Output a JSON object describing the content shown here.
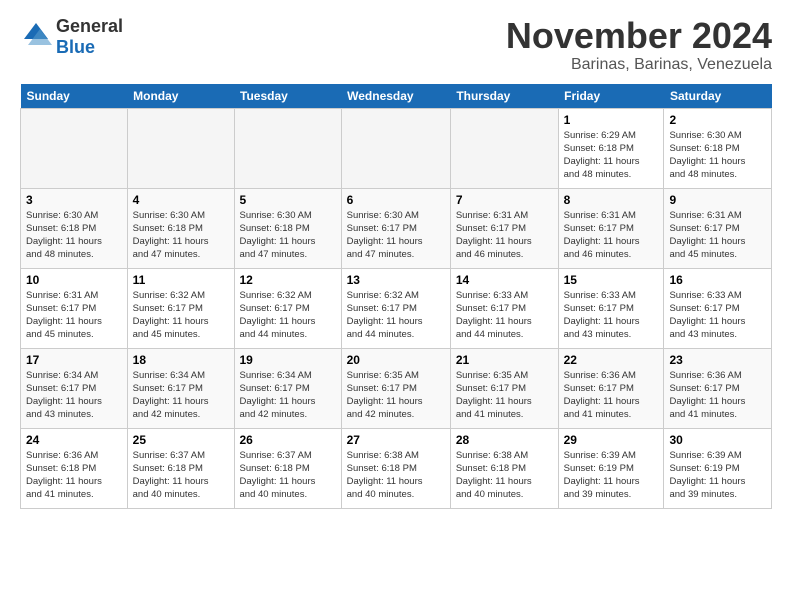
{
  "logo": {
    "general": "General",
    "blue": "Blue"
  },
  "title": "November 2024",
  "subtitle": "Barinas, Barinas, Venezuela",
  "headers": [
    "Sunday",
    "Monday",
    "Tuesday",
    "Wednesday",
    "Thursday",
    "Friday",
    "Saturday"
  ],
  "weeks": [
    [
      {
        "day": "",
        "detail": ""
      },
      {
        "day": "",
        "detail": ""
      },
      {
        "day": "",
        "detail": ""
      },
      {
        "day": "",
        "detail": ""
      },
      {
        "day": "",
        "detail": ""
      },
      {
        "day": "1",
        "detail": "Sunrise: 6:29 AM\nSunset: 6:18 PM\nDaylight: 11 hours\nand 48 minutes."
      },
      {
        "day": "2",
        "detail": "Sunrise: 6:30 AM\nSunset: 6:18 PM\nDaylight: 11 hours\nand 48 minutes."
      }
    ],
    [
      {
        "day": "3",
        "detail": "Sunrise: 6:30 AM\nSunset: 6:18 PM\nDaylight: 11 hours\nand 48 minutes."
      },
      {
        "day": "4",
        "detail": "Sunrise: 6:30 AM\nSunset: 6:18 PM\nDaylight: 11 hours\nand 47 minutes."
      },
      {
        "day": "5",
        "detail": "Sunrise: 6:30 AM\nSunset: 6:18 PM\nDaylight: 11 hours\nand 47 minutes."
      },
      {
        "day": "6",
        "detail": "Sunrise: 6:30 AM\nSunset: 6:17 PM\nDaylight: 11 hours\nand 47 minutes."
      },
      {
        "day": "7",
        "detail": "Sunrise: 6:31 AM\nSunset: 6:17 PM\nDaylight: 11 hours\nand 46 minutes."
      },
      {
        "day": "8",
        "detail": "Sunrise: 6:31 AM\nSunset: 6:17 PM\nDaylight: 11 hours\nand 46 minutes."
      },
      {
        "day": "9",
        "detail": "Sunrise: 6:31 AM\nSunset: 6:17 PM\nDaylight: 11 hours\nand 45 minutes."
      }
    ],
    [
      {
        "day": "10",
        "detail": "Sunrise: 6:31 AM\nSunset: 6:17 PM\nDaylight: 11 hours\nand 45 minutes."
      },
      {
        "day": "11",
        "detail": "Sunrise: 6:32 AM\nSunset: 6:17 PM\nDaylight: 11 hours\nand 45 minutes."
      },
      {
        "day": "12",
        "detail": "Sunrise: 6:32 AM\nSunset: 6:17 PM\nDaylight: 11 hours\nand 44 minutes."
      },
      {
        "day": "13",
        "detail": "Sunrise: 6:32 AM\nSunset: 6:17 PM\nDaylight: 11 hours\nand 44 minutes."
      },
      {
        "day": "14",
        "detail": "Sunrise: 6:33 AM\nSunset: 6:17 PM\nDaylight: 11 hours\nand 44 minutes."
      },
      {
        "day": "15",
        "detail": "Sunrise: 6:33 AM\nSunset: 6:17 PM\nDaylight: 11 hours\nand 43 minutes."
      },
      {
        "day": "16",
        "detail": "Sunrise: 6:33 AM\nSunset: 6:17 PM\nDaylight: 11 hours\nand 43 minutes."
      }
    ],
    [
      {
        "day": "17",
        "detail": "Sunrise: 6:34 AM\nSunset: 6:17 PM\nDaylight: 11 hours\nand 43 minutes."
      },
      {
        "day": "18",
        "detail": "Sunrise: 6:34 AM\nSunset: 6:17 PM\nDaylight: 11 hours\nand 42 minutes."
      },
      {
        "day": "19",
        "detail": "Sunrise: 6:34 AM\nSunset: 6:17 PM\nDaylight: 11 hours\nand 42 minutes."
      },
      {
        "day": "20",
        "detail": "Sunrise: 6:35 AM\nSunset: 6:17 PM\nDaylight: 11 hours\nand 42 minutes."
      },
      {
        "day": "21",
        "detail": "Sunrise: 6:35 AM\nSunset: 6:17 PM\nDaylight: 11 hours\nand 41 minutes."
      },
      {
        "day": "22",
        "detail": "Sunrise: 6:36 AM\nSunset: 6:17 PM\nDaylight: 11 hours\nand 41 minutes."
      },
      {
        "day": "23",
        "detail": "Sunrise: 6:36 AM\nSunset: 6:17 PM\nDaylight: 11 hours\nand 41 minutes."
      }
    ],
    [
      {
        "day": "24",
        "detail": "Sunrise: 6:36 AM\nSunset: 6:18 PM\nDaylight: 11 hours\nand 41 minutes."
      },
      {
        "day": "25",
        "detail": "Sunrise: 6:37 AM\nSunset: 6:18 PM\nDaylight: 11 hours\nand 40 minutes."
      },
      {
        "day": "26",
        "detail": "Sunrise: 6:37 AM\nSunset: 6:18 PM\nDaylight: 11 hours\nand 40 minutes."
      },
      {
        "day": "27",
        "detail": "Sunrise: 6:38 AM\nSunset: 6:18 PM\nDaylight: 11 hours\nand 40 minutes."
      },
      {
        "day": "28",
        "detail": "Sunrise: 6:38 AM\nSunset: 6:18 PM\nDaylight: 11 hours\nand 40 minutes."
      },
      {
        "day": "29",
        "detail": "Sunrise: 6:39 AM\nSunset: 6:19 PM\nDaylight: 11 hours\nand 39 minutes."
      },
      {
        "day": "30",
        "detail": "Sunrise: 6:39 AM\nSunset: 6:19 PM\nDaylight: 11 hours\nand 39 minutes."
      }
    ]
  ]
}
